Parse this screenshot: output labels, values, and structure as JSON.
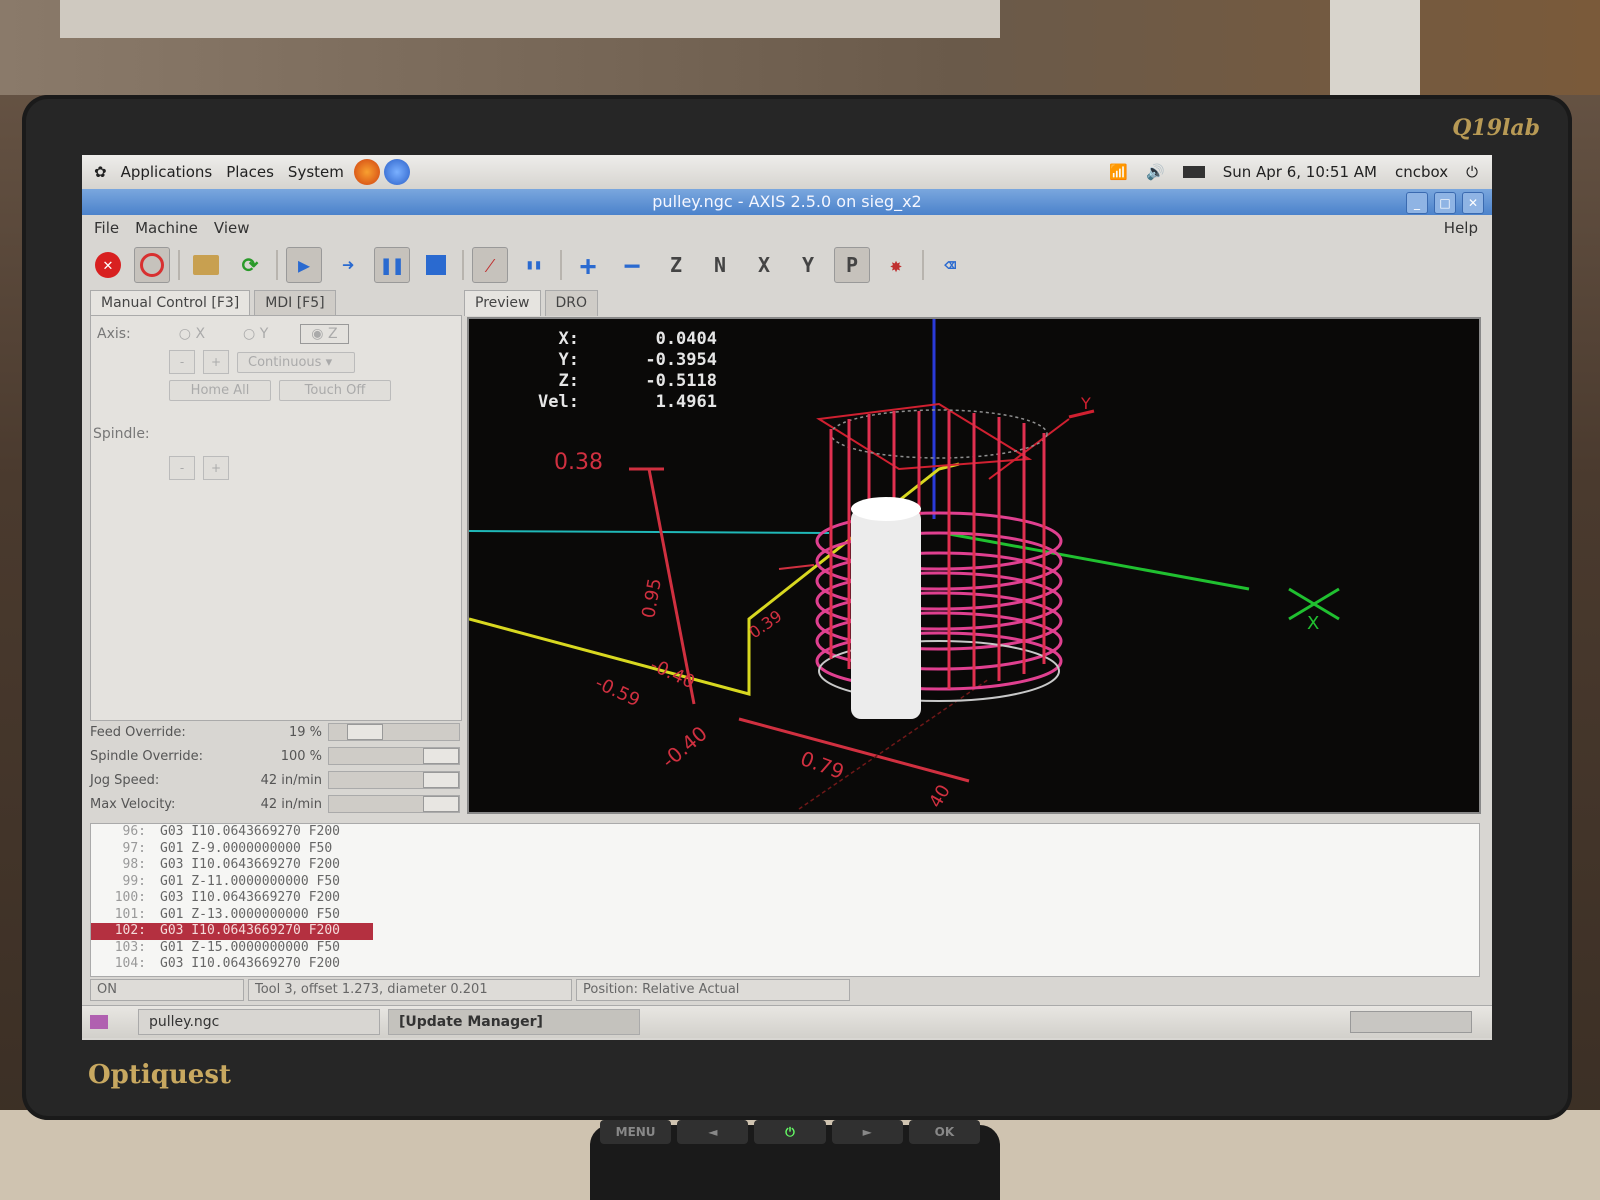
{
  "gnome_panel": {
    "menus": [
      "Applications",
      "Places",
      "System"
    ],
    "clock": "Sun Apr 6, 10:51 AM",
    "user": "cncbox"
  },
  "window": {
    "title": "pulley.ngc - AXIS 2.5.0 on sieg_x2"
  },
  "menubar": {
    "file": "File",
    "machine": "Machine",
    "view": "View",
    "help": "Help"
  },
  "toolbar": {
    "zoom_in": "+",
    "zoom_out": "−",
    "view_z": "Z",
    "view_z2": "N",
    "view_x": "X",
    "view_y": "Y",
    "view_p": "P"
  },
  "left_tabs": [
    "Manual Control [F3]",
    "MDI [F5]"
  ],
  "manual": {
    "axis_label": "Axis:",
    "axis_x": "X",
    "axis_y": "Y",
    "axis_z": "Z",
    "minus": "-",
    "plus": "+",
    "jog_mode": "Continuous",
    "home_all": "Home All",
    "touch_off": "Touch Off",
    "spindle_label": "Spindle:"
  },
  "sliders": [
    {
      "label": "Feed Override:",
      "value": "19 %",
      "level": 0.19
    },
    {
      "label": "Spindle Override:",
      "value": "100 %",
      "level": 1.0
    },
    {
      "label": "Jog Speed:",
      "value": "42 in/min",
      "level": 1.0
    },
    {
      "label": "Max Velocity:",
      "value": "42 in/min",
      "level": 1.0
    }
  ],
  "right_tabs": [
    "Preview",
    "DRO"
  ],
  "dro": {
    "x_label": "X:",
    "x_value": "0.0404",
    "y_label": "Y:",
    "y_value": "-0.3954",
    "z_label": "Z:",
    "z_value": "-0.5118",
    "vel_label": "Vel:",
    "vel_value": "1.4961"
  },
  "preview_labels": {
    "d1": "0.38",
    "d2": "0.95",
    "d3": "-0.40",
    "d4": "-0.59",
    "d5": "0.39",
    "d6": "-0.40",
    "d7": "0.79",
    "d8": "40",
    "axis_x": "X",
    "axis_y": "Y"
  },
  "gcode": [
    {
      "n": "96:",
      "text": "G03 I10.0643669270 F200",
      "current": false
    },
    {
      "n": "97:",
      "text": "G01 Z-9.0000000000 F50",
      "current": false
    },
    {
      "n": "98:",
      "text": "G03 I10.0643669270 F200",
      "current": false
    },
    {
      "n": "99:",
      "text": "G01 Z-11.0000000000 F50",
      "current": false
    },
    {
      "n": "100:",
      "text": "G03 I10.0643669270 F200",
      "current": false
    },
    {
      "n": "101:",
      "text": "G01 Z-13.0000000000 F50",
      "current": false
    },
    {
      "n": "102:",
      "text": "G03 I10.0643669270 F200",
      "current": true
    },
    {
      "n": "103:",
      "text": "G01 Z-15.0000000000 F50",
      "current": false
    },
    {
      "n": "104:",
      "text": "G03 I10.0643669270 F200",
      "current": false
    }
  ],
  "status": {
    "state": "ON",
    "tool": "Tool 3, offset 1.273, diameter 0.201",
    "position": "Position: Relative Actual"
  },
  "taskbar": {
    "task1": "pulley.ngc",
    "task2": "[Update Manager]"
  },
  "monitor": {
    "brand_top": "Q19lab",
    "brand_bottom": "Optiquest",
    "buttons": [
      "MENU",
      "◄",
      "⏻",
      "►",
      "OK"
    ]
  }
}
